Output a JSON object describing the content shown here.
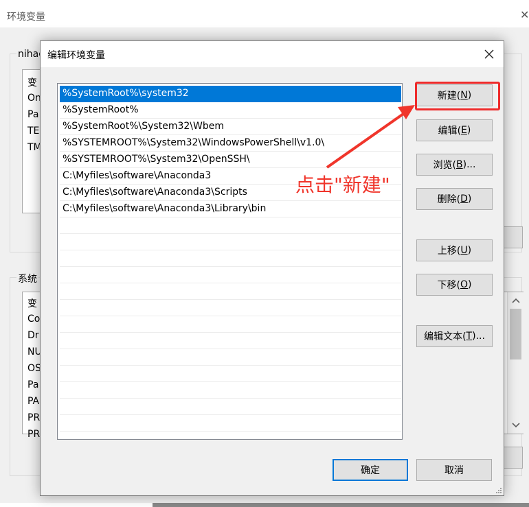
{
  "background_window": {
    "title": "环境变量",
    "user_group_label": "nihac",
    "user_list_items": [
      "变",
      "On",
      "Pa",
      "TE",
      "TM"
    ],
    "system_group_label": "系统",
    "system_list_items": [
      "变",
      "Co",
      "Dr",
      "NU",
      "OS",
      "Pa",
      "PA",
      "PR",
      "PR"
    ]
  },
  "dialog": {
    "title": "编辑环境变量",
    "paths": [
      "%SystemRoot%\\system32",
      "%SystemRoot%",
      "%SystemRoot%\\System32\\Wbem",
      "%SYSTEMROOT%\\System32\\WindowsPowerShell\\v1.0\\",
      "%SYSTEMROOT%\\System32\\OpenSSH\\",
      "C:\\Myfiles\\software\\Anaconda3",
      "C:\\Myfiles\\software\\Anaconda3\\Scripts",
      "C:\\Myfiles\\software\\Anaconda3\\Library\\bin"
    ],
    "buttons": {
      "new": {
        "label": "新建(",
        "key": "N",
        "suffix": ")"
      },
      "edit": {
        "label": "编辑(",
        "key": "E",
        "suffix": ")"
      },
      "browse": {
        "label": "浏览(",
        "key": "B",
        "suffix": ")..."
      },
      "delete": {
        "label": "删除(",
        "key": "D",
        "suffix": ")"
      },
      "move_up": {
        "label": "上移(",
        "key": "U",
        "suffix": ")"
      },
      "move_down": {
        "label": "下移(",
        "key": "O",
        "suffix": ")"
      },
      "edit_text": {
        "label": "编辑文本(",
        "key": "T",
        "suffix": ")..."
      },
      "ok": {
        "label": "确定"
      },
      "cancel": {
        "label": "取消"
      }
    }
  },
  "annotation": {
    "text": "点击\"新建\"",
    "color": "#f0352b"
  },
  "colors": {
    "selection": "#0078d7",
    "highlight": "#ee2b2b"
  }
}
